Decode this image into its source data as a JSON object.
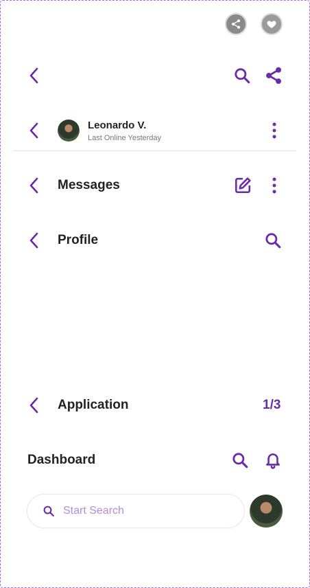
{
  "top_actions": {
    "share_icon": "share-icon",
    "heart_icon": "heart-icon"
  },
  "nav_bar_1": {
    "search_icon": "search-icon",
    "share_icon": "share-icon"
  },
  "chat_header": {
    "name": "Leonardo V.",
    "status": "Last Online Yesterday"
  },
  "messages_header": {
    "title": "Messages"
  },
  "profile_header": {
    "title": "Profile"
  },
  "application_header": {
    "title": "Application",
    "counter": "1/3"
  },
  "dashboard_header": {
    "title": "Dashboard"
  },
  "search": {
    "placeholder": "Start Search"
  },
  "colors": {
    "accent": "#6b2aa8",
    "accent_light": "#b48ad9",
    "border": "#a46be6"
  }
}
